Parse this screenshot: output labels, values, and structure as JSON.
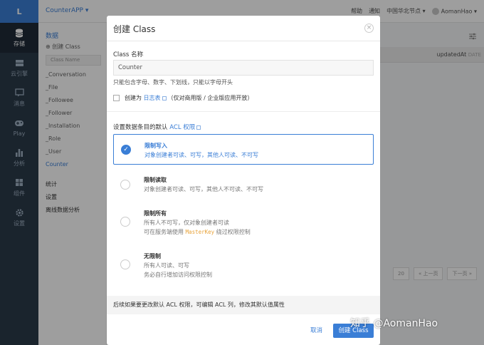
{
  "nav": {
    "logo": "L",
    "items": [
      {
        "label": "存储",
        "icon": "database-icon"
      },
      {
        "label": "云引擎",
        "icon": "cloud-engine-icon"
      },
      {
        "label": "消息",
        "icon": "message-icon"
      },
      {
        "label": "Play",
        "icon": "gamepad-icon"
      },
      {
        "label": "分析",
        "icon": "bar-chart-icon"
      },
      {
        "label": "组件",
        "icon": "components-icon"
      },
      {
        "label": "设置",
        "icon": "gear-icon"
      }
    ]
  },
  "topbar": {
    "app": "CounterAPP",
    "links": [
      "帮助",
      "通知",
      "中国华北节点"
    ],
    "user": "AomanHao"
  },
  "sidebar": {
    "section": "数据",
    "create": "创建 Class",
    "search_placeholder": "Class Name",
    "classes": [
      "_Conversation",
      "_File",
      "_Followee",
      "_Follower",
      "_Installation",
      "_Role",
      "_User",
      "Counter"
    ],
    "bottom": [
      "统计",
      "设置",
      "离线数据分析"
    ]
  },
  "table": {
    "column": "updatedAt",
    "column_type": "DATE"
  },
  "pager": {
    "size": "20",
    "prev": "« 上一页",
    "next": "下一页 »"
  },
  "modal": {
    "title": "创建 Class",
    "name_label": "Class 名称",
    "name_value": "Counter",
    "name_hint": "只能包含字母、数字、下划线，只能以字母开头",
    "log_prefix": "创建为",
    "log_link": "日志表",
    "log_suffix": "（仅对商用版 / 企业版应用开放）",
    "acl_prefix": "设置数据条目的默认",
    "acl_link": "ACL 权限",
    "options": [
      {
        "title": "限制写入",
        "desc": "对象创建者可读、可写，其他人可读、不可写",
        "desc2": "",
        "selected": true
      },
      {
        "title": "限制读取",
        "desc": "对象创建者可读、可写，其他人不可读、不可写",
        "desc2": "",
        "selected": false
      },
      {
        "title": "限制所有",
        "desc": "所有人不可写，仅对象创建者可读",
        "desc2_pre": "可在服务端使用",
        "desc2_code": "MasterKey",
        "desc2_post": "绕过权限控制",
        "selected": false
      },
      {
        "title": "无限制",
        "desc": "所有人可读、可写",
        "desc2": "务必自行增加访问权限控制",
        "selected": false
      }
    ],
    "footer_note": "后续如果要更改默认 ACL 权限，可编辑 ACL 列，修改其默认值属性",
    "cancel": "取消",
    "confirm": "创建 Class"
  },
  "watermark": "知乎 @AomanHao",
  "colors": {
    "accent": "#3a7ed6",
    "nav_bg": "#2b3a4a",
    "code": "#e8a33a"
  }
}
